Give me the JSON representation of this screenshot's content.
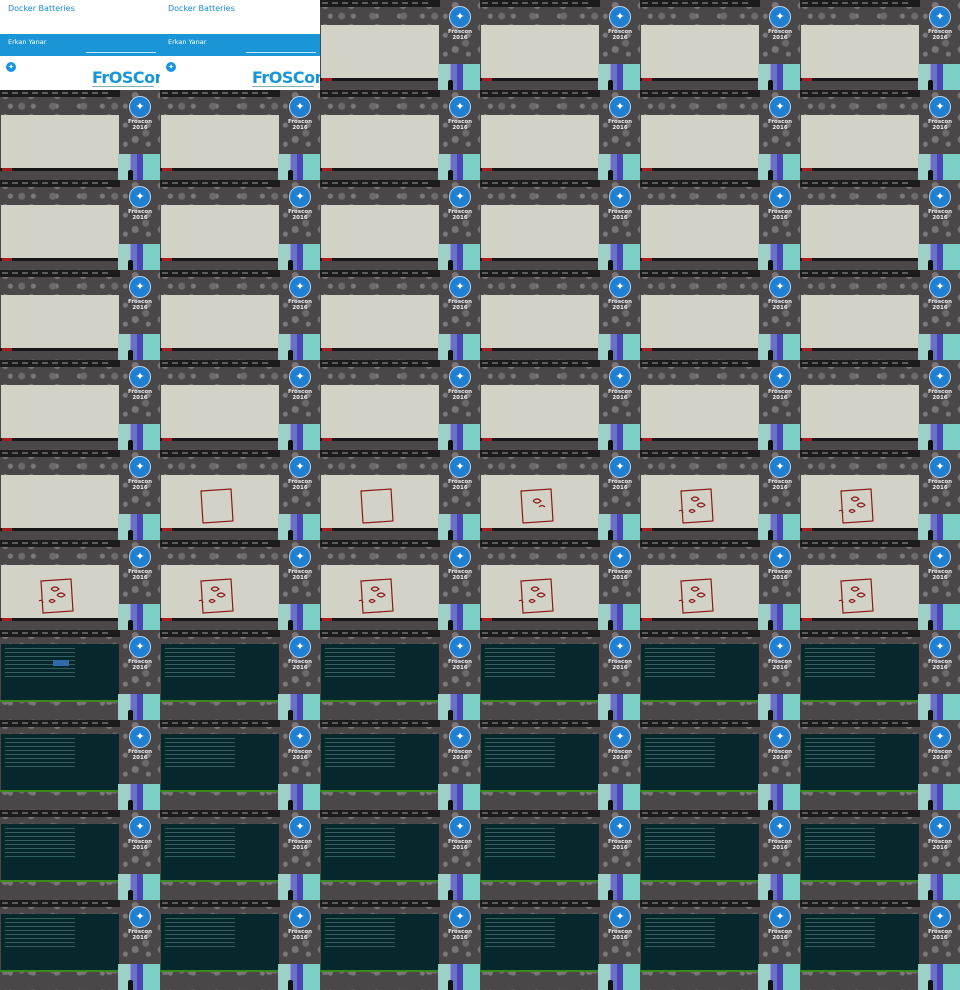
{
  "title_card": {
    "talk_title": "Docker Batteries",
    "speaker": "Erkan Yanar",
    "brand": "FrOSCon"
  },
  "overlay_brand": "Froscon 2016",
  "grid": {
    "columns": 6,
    "rows": 11
  },
  "tile_types": [
    "title",
    "title",
    "slide",
    "slide",
    "slide",
    "slide",
    "slide",
    "slide",
    "slide",
    "slide",
    "slide",
    "slide",
    "slide",
    "slide",
    "slide",
    "slide",
    "slide",
    "slide",
    "slide",
    "slide",
    "slide",
    "slide",
    "slide",
    "slide",
    "slide",
    "slide",
    "slide",
    "slide",
    "slide",
    "slide",
    "slide",
    "draw1",
    "draw1",
    "draw2",
    "draw3",
    "draw3",
    "draw3",
    "draw3",
    "draw3",
    "draw3",
    "draw3",
    "draw3",
    "term",
    "term",
    "term",
    "term",
    "term",
    "term",
    "term",
    "term",
    "term",
    "term",
    "term",
    "term",
    "term",
    "term",
    "term",
    "term",
    "term",
    "term",
    "term",
    "term",
    "term",
    "term",
    "term",
    "term"
  ],
  "colors": {
    "slide_bg": "#d3d2c6",
    "terminal_bg": "#06282c",
    "brand_blue": "#1a96d6",
    "drawing_red": "#8b1a1a"
  }
}
